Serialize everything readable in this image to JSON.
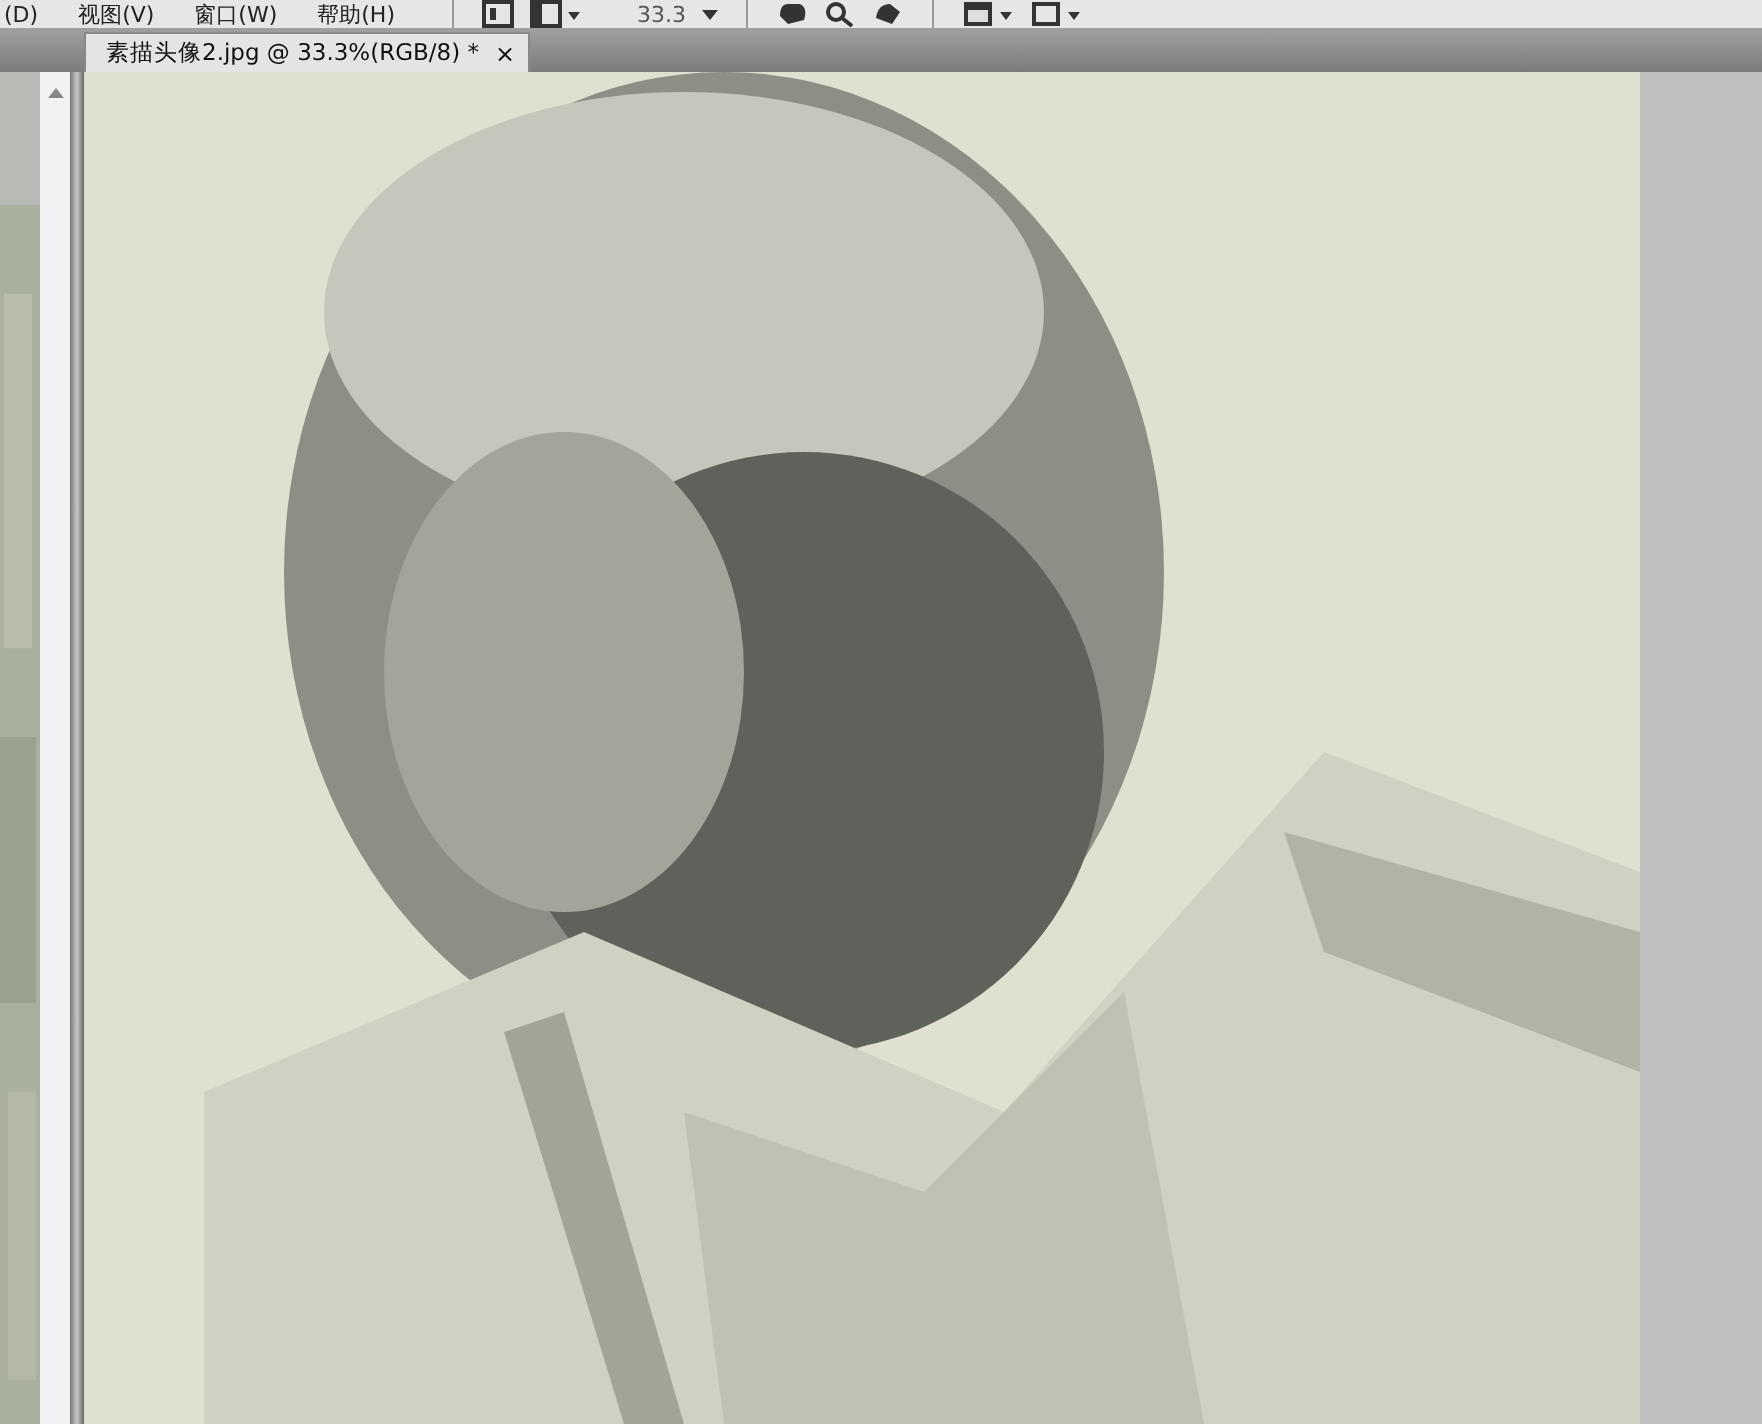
{
  "menu_bar": {
    "items": [
      "(D)",
      "视图(V)",
      "窗口(W)",
      "帮助(H)"
    ]
  },
  "toolbar": {
    "zoom_value": "33.3"
  },
  "tabs": [
    {
      "label": "素描头像2.jpg @ 33.3%(RGB/8) *",
      "close": "×",
      "selected": true
    }
  ]
}
